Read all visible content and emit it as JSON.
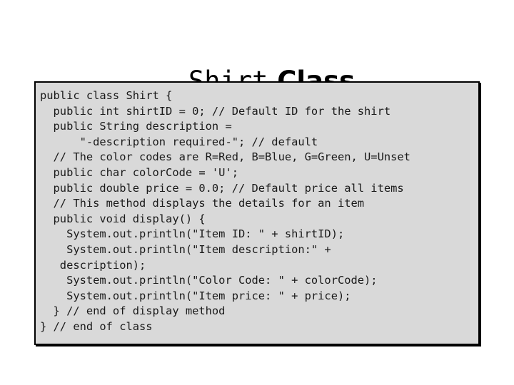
{
  "slide": {
    "title": {
      "mono_part": "Shirt",
      "sans_part": " Class",
      "full": "Shirt Class"
    },
    "code_box": {
      "background_color": "#d9d9d9",
      "border_color": "#000000",
      "text_color": "#1a1a1a",
      "language": "java",
      "lines": [
        "public class Shirt {",
        "  public int shirtID = 0; // Default ID for the shirt",
        "  public String description =",
        "      \"-description required-\"; // default",
        "  // The color codes are R=Red, B=Blue, G=Green, U=Unset",
        "  public char colorCode = 'U';",
        "  public double price = 0.0; // Default price all items",
        "  // This method displays the details for an item",
        "  public void display() {",
        "    System.out.println(\"Item ID: \" + shirtID);",
        "    System.out.println(\"Item description:\" +",
        "   description);",
        "    System.out.println(\"Color Code: \" + colorCode);",
        "    System.out.println(\"Item price: \" + price);",
        "  } // end of display method",
        "} // end of class"
      ]
    }
  }
}
